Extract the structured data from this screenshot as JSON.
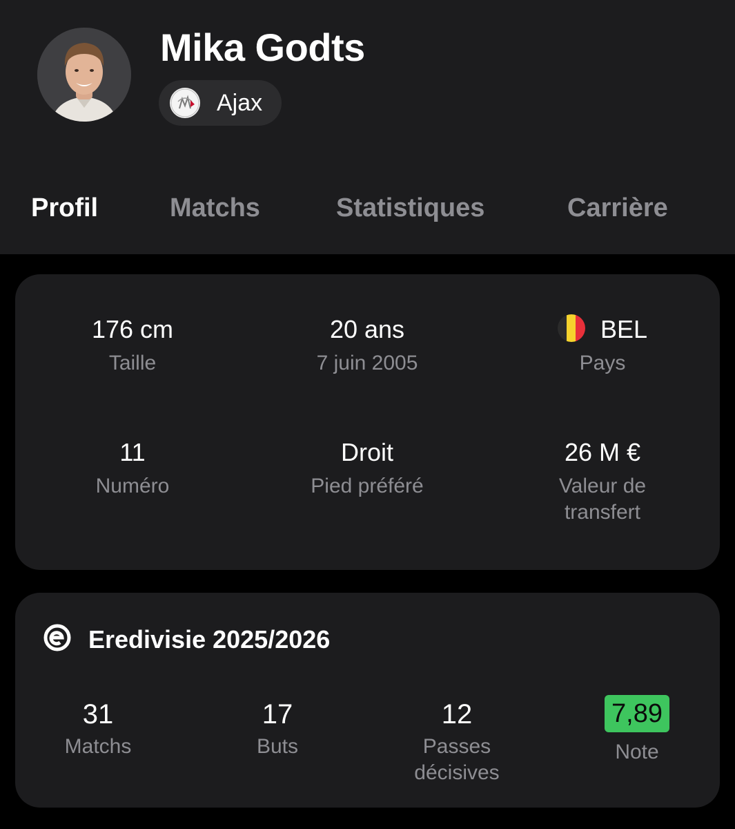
{
  "player": {
    "name": "Mika Godts",
    "club": "Ajax",
    "avatar_icon": "player-photo",
    "club_icon": "ajax-crest-icon"
  },
  "tabs": [
    {
      "label": "Profil",
      "active": true
    },
    {
      "label": "Matchs",
      "active": false
    },
    {
      "label": "Statistiques",
      "active": false
    },
    {
      "label": "Carrière",
      "active": false
    }
  ],
  "profile": {
    "height": {
      "value": "176 cm",
      "label": "Taille"
    },
    "age": {
      "value": "20 ans",
      "label": "7 juin 2005"
    },
    "country": {
      "value": "BEL",
      "label": "Pays",
      "flag_icon": "belgium-flag-icon"
    },
    "number": {
      "value": "11",
      "label": "Numéro"
    },
    "foot": {
      "value": "Droit",
      "label": "Pied préféré"
    },
    "market_value": {
      "value": "26 M €",
      "label_line1": "Valeur de",
      "label_line2": "transfert"
    }
  },
  "season": {
    "title": "Eredivisie 2025/2026",
    "league_icon": "eredivisie-icon",
    "stats": [
      {
        "value": "31",
        "label": "Matchs"
      },
      {
        "value": "17",
        "label": "Buts"
      },
      {
        "value": "12",
        "label_line1": "Passes",
        "label_line2": "décisives"
      },
      {
        "value": "7,89",
        "label": "Note"
      }
    ]
  },
  "colors": {
    "background": "#000000",
    "surface": "#1c1c1e",
    "muted_text": "#8e8e93",
    "rating_green": "#3ec55e"
  }
}
